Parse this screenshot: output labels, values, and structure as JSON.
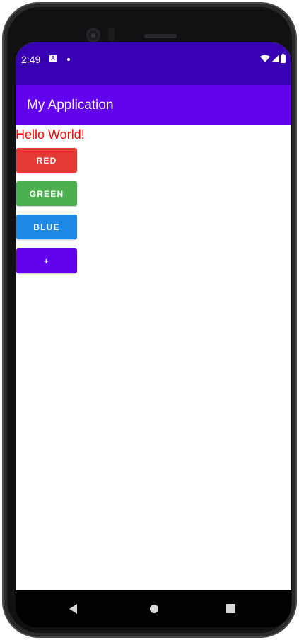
{
  "status_bar": {
    "time": "2:49",
    "notification_icon": "A",
    "background": "#3700b3"
  },
  "app_bar": {
    "title": "My Application",
    "background": "#6200ee"
  },
  "content": {
    "hello_text": "Hello World!",
    "hello_color": "#ff0000",
    "buttons": [
      {
        "label": "RED",
        "color": "#e53935"
      },
      {
        "label": "GREEN",
        "color": "#4caf50"
      },
      {
        "label": "BLUE",
        "color": "#1e88e5"
      },
      {
        "label": "+",
        "color": "#6200ee"
      }
    ]
  },
  "nav_bar": {
    "icons": [
      "back-icon",
      "home-icon",
      "recents-icon"
    ]
  }
}
